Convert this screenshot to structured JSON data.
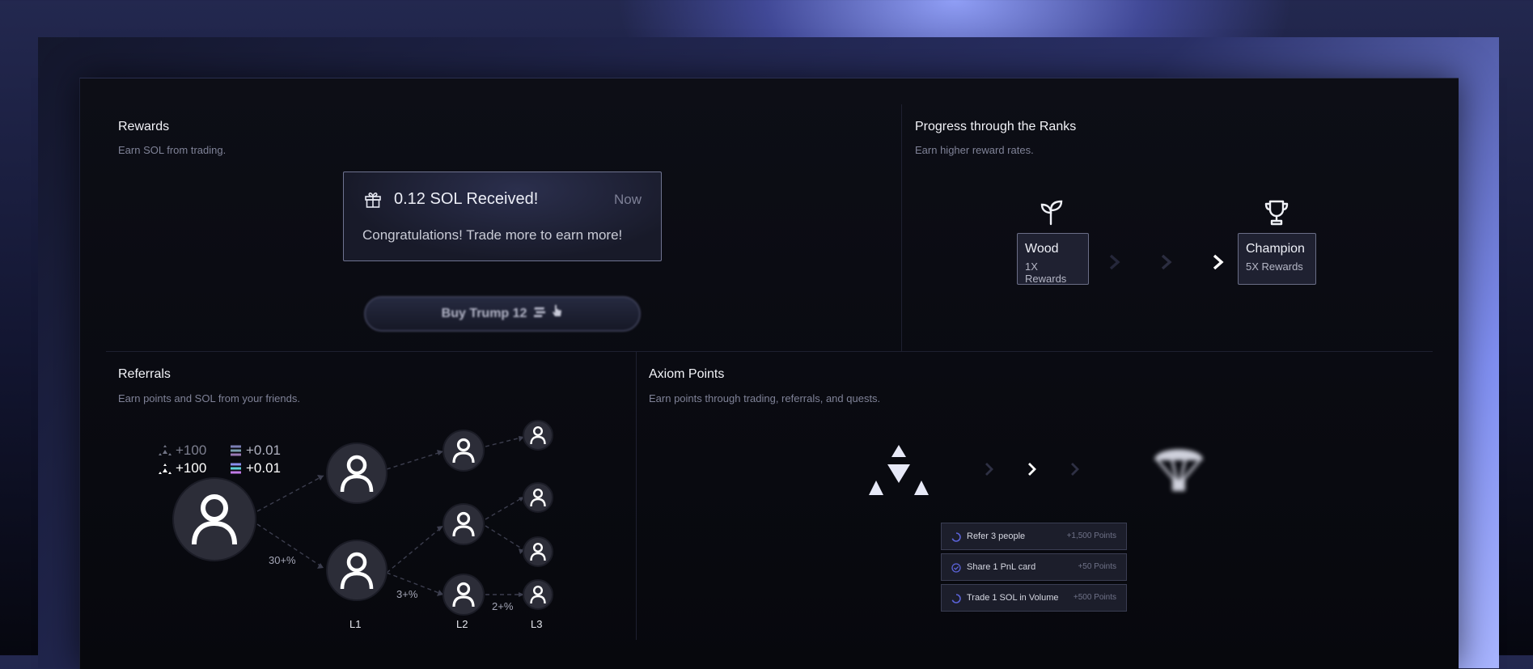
{
  "rewards": {
    "title": "Rewards",
    "subtitle": "Earn SOL from trading.",
    "notification": {
      "title": "0.12 SOL Received!",
      "time": "Now",
      "message": "Congratulations! Trade more to earn more!"
    },
    "buy_button": "Buy Trump 12"
  },
  "ranks": {
    "title": "Progress through the Ranks",
    "subtitle": "Earn higher reward rates.",
    "from": {
      "name": "Wood",
      "rewards": "1X Rewards",
      "icon": "sprout-icon"
    },
    "to": {
      "name": "Champion",
      "rewards": "5X Rewards",
      "icon": "trophy-icon"
    }
  },
  "referrals": {
    "title": "Referrals",
    "subtitle": "Earn points and SOL from your friends.",
    "stats_faded": {
      "points": "+100",
      "sol": "+0.01"
    },
    "stats": {
      "points": "+100",
      "sol": "+0.01"
    },
    "percentages": {
      "l1": "30+%",
      "l2": "3+%",
      "l3": "2+%"
    },
    "levels": [
      "L1",
      "L2",
      "L3"
    ]
  },
  "axiom": {
    "title": "Axiom Points",
    "subtitle": "Earn points through trading, referrals, and quests.",
    "quests": [
      {
        "name": "Refer 3 people",
        "points": "+1,500 Points",
        "status": "in-progress"
      },
      {
        "name": "Share 1 PnL card",
        "points": "+50 Points",
        "status": "completed"
      },
      {
        "name": "Trade 1 SOL in Volume",
        "points": "+500 Points",
        "status": "in-progress"
      }
    ]
  },
  "colors": {
    "accent": "#5b63d9",
    "panel": "#0b0c13",
    "glow": "#a9b5ff"
  }
}
